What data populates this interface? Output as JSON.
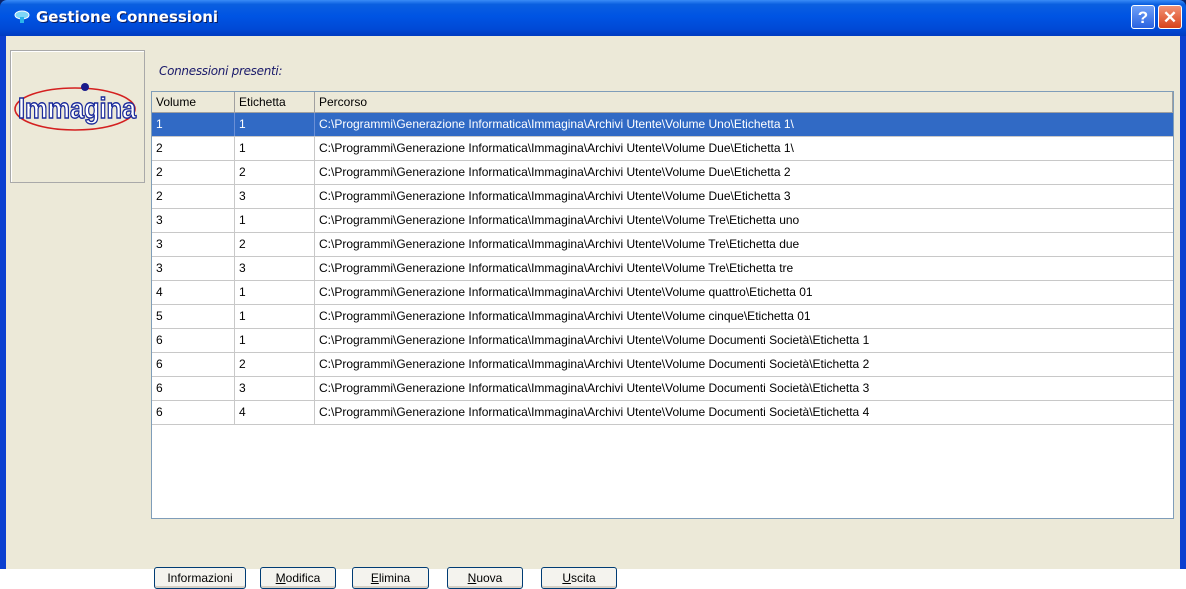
{
  "window": {
    "title": "Gestione Connessioni",
    "help_glyph": "?",
    "close_glyph": "✕",
    "title_icon": "connection-icon"
  },
  "logo": {
    "text": "Immagina",
    "icon": "immagina-logo"
  },
  "section_label": "Connessioni presenti:",
  "table": {
    "columns": [
      "Volume",
      "Etichetta",
      "Percorso"
    ],
    "rows": [
      {
        "volume": "1",
        "etichetta": "1",
        "percorso": "C:\\Programmi\\Generazione Informatica\\Immagina\\Archivi Utente\\Volume Uno\\Etichetta 1\\",
        "selected": true
      },
      {
        "volume": "2",
        "etichetta": "1",
        "percorso": "C:\\Programmi\\Generazione Informatica\\Immagina\\Archivi Utente\\Volume Due\\Etichetta 1\\"
      },
      {
        "volume": "2",
        "etichetta": "2",
        "percorso": "C:\\Programmi\\Generazione Informatica\\Immagina\\Archivi Utente\\Volume Due\\Etichetta 2"
      },
      {
        "volume": "2",
        "etichetta": "3",
        "percorso": "C:\\Programmi\\Generazione Informatica\\Immagina\\Archivi Utente\\Volume Due\\Etichetta 3"
      },
      {
        "volume": "3",
        "etichetta": "1",
        "percorso": "C:\\Programmi\\Generazione Informatica\\Immagina\\Archivi Utente\\Volume Tre\\Etichetta uno"
      },
      {
        "volume": "3",
        "etichetta": "2",
        "percorso": "C:\\Programmi\\Generazione Informatica\\Immagina\\Archivi Utente\\Volume Tre\\Etichetta due"
      },
      {
        "volume": "3",
        "etichetta": "3",
        "percorso": "C:\\Programmi\\Generazione Informatica\\Immagina\\Archivi Utente\\Volume Tre\\Etichetta tre"
      },
      {
        "volume": "4",
        "etichetta": "1",
        "percorso": "C:\\Programmi\\Generazione Informatica\\Immagina\\Archivi Utente\\Volume quattro\\Etichetta 01"
      },
      {
        "volume": "5",
        "etichetta": "1",
        "percorso": "C:\\Programmi\\Generazione Informatica\\Immagina\\Archivi Utente\\Volume cinque\\Etichetta 01"
      },
      {
        "volume": "6",
        "etichetta": "1",
        "percorso": "C:\\Programmi\\Generazione Informatica\\Immagina\\Archivi Utente\\Volume Documenti Società\\Etichetta 1"
      },
      {
        "volume": "6",
        "etichetta": "2",
        "percorso": "C:\\Programmi\\Generazione Informatica\\Immagina\\Archivi Utente\\Volume Documenti Società\\Etichetta 2"
      },
      {
        "volume": "6",
        "etichetta": "3",
        "percorso": "C:\\Programmi\\Generazione Informatica\\Immagina\\Archivi Utente\\Volume Documenti Società\\Etichetta 3"
      },
      {
        "volume": "6",
        "etichetta": "4",
        "percorso": "C:\\Programmi\\Generazione Informatica\\Immagina\\Archivi Utente\\Volume Documenti Società\\Etichetta 4"
      }
    ]
  },
  "buttons": [
    {
      "label": "Informazioni",
      "name": "informazioni-button"
    },
    {
      "accel": "M",
      "rest": "odifica",
      "name": "modifica-button"
    },
    {
      "accel": "E",
      "rest": "limina",
      "name": "elimina-button"
    },
    {
      "accel": "N",
      "rest": "uova",
      "name": "nuova-button"
    },
    {
      "accel": "U",
      "rest": "scita",
      "name": "uscita-button"
    }
  ],
  "colors": {
    "titlebar": "#0054e3",
    "selection": "#316ac5",
    "dialog_bg": "#ece9d8",
    "close": "#d8431c"
  }
}
